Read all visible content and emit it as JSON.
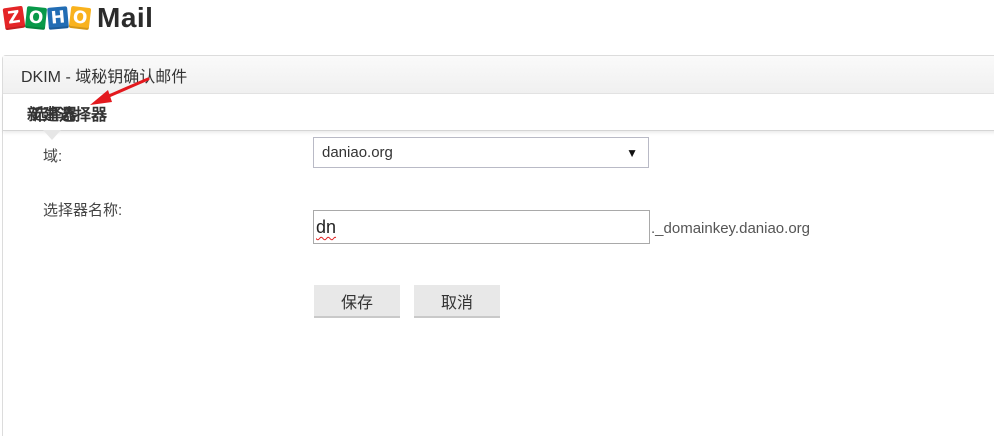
{
  "logo": {
    "letters": [
      "Z",
      "O",
      "H",
      "O"
    ],
    "colors": [
      "#e42527",
      "#089949",
      "#226db4",
      "#f9b21d"
    ],
    "product": "Mail"
  },
  "header": {
    "title": "DKIM - 域秘钥确认邮件"
  },
  "tab": {
    "label": "选择器"
  },
  "form": {
    "section_title": "新建选择器",
    "domain_label": "域:",
    "domain_value": "daniao.org",
    "domain_arrow": "▼",
    "selector_label": "选择器名称:",
    "selector_value": "dn",
    "selector_suffix": "._domainkey.daniao.org",
    "save_label": "保存",
    "cancel_label": "取消"
  },
  "annotation": {
    "arrow_color": "#e3191e"
  }
}
